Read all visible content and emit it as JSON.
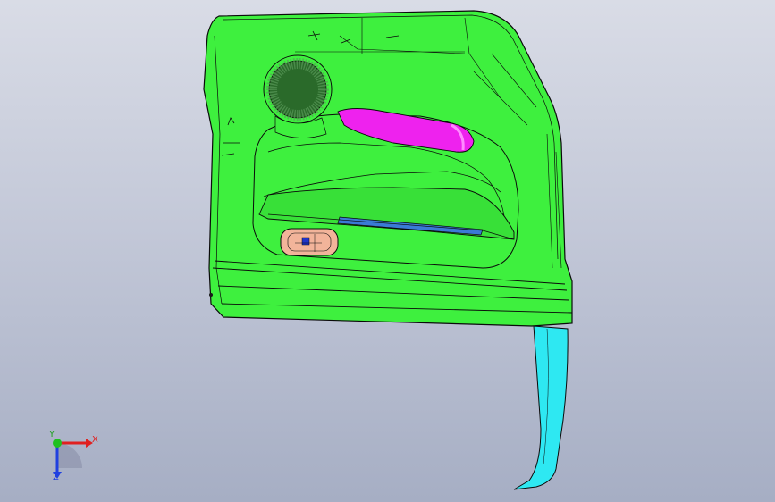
{
  "viewport": {
    "background_top": "#d9dce6",
    "background_bottom": "#a6aec4"
  },
  "model": {
    "panel_color": "#3ef03e",
    "armrest_insert_color": "#ee22ee",
    "pocket_strip_color": "#3a7bd5",
    "handle_bezel_color": "#f2b49a",
    "lower_extension_color": "#2ee8f2",
    "edge_color": "#0a0a0a"
  },
  "triad": {
    "x_label": "X",
    "y_label": "Y",
    "z_label": "Z",
    "x_color": "#e02020",
    "y_color": "#20c020",
    "z_color": "#2040e0"
  }
}
